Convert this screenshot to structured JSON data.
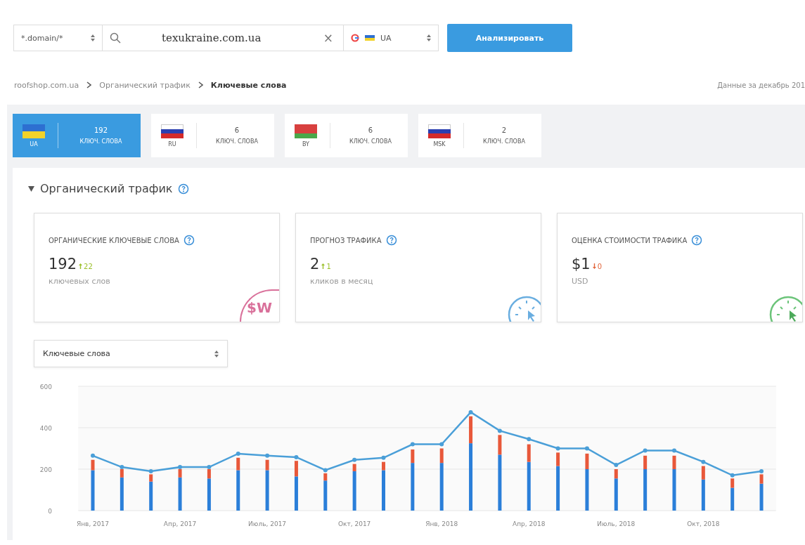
{
  "search_bar": {
    "mode_select": "*.domain/*",
    "query": "texukraine.com.ua",
    "clear": "×",
    "engine_select": "UA",
    "analyze_button": "Анализировать"
  },
  "breadcrumbs": [
    {
      "label": "roofshop.com.ua",
      "current": false
    },
    {
      "label": "Органический трафик",
      "current": false
    },
    {
      "label": "Ключевые слова",
      "current": true
    }
  ],
  "data_note": "Данные за декабрь 201",
  "region_tabs": [
    {
      "code": "UA",
      "count": "192",
      "label": "КЛЮЧ. СЛОВА",
      "selected": true,
      "kind": "ua"
    },
    {
      "code": "RU",
      "count": "6",
      "label": "КЛЮЧ. СЛОВА",
      "selected": false,
      "kind": "ru"
    },
    {
      "code": "BY",
      "count": "6",
      "label": "КЛЮЧ. СЛОВА",
      "selected": false,
      "kind": "by"
    },
    {
      "code": "MSK",
      "count": "2",
      "label": "КЛЮЧ. СЛОВА",
      "selected": false,
      "kind": "ru"
    }
  ],
  "section": {
    "title": "Органический трафик",
    "expanded": true
  },
  "cards": [
    {
      "title": "ОРГАНИЧЕСКИЕ КЛЮЧЕВЫЕ СЛОВА",
      "value": "192",
      "change": "22",
      "rising": true,
      "caption": "ключевых слов",
      "kind": "keywords",
      "badge": "$W"
    },
    {
      "title": "ПРОГНОЗ ТРАФИКА",
      "value": "2",
      "change": "1",
      "rising": true,
      "caption": "кликов в месяц",
      "kind": "clicks"
    },
    {
      "title": "ОЦЕНКА СТОИМОСТИ ТРАФИКА",
      "value": "$1",
      "change": "0",
      "rising": false,
      "caption": "USD",
      "kind": "cost"
    }
  ],
  "metric_select": "Ключевые слова",
  "chart_data": {
    "type": "bar",
    "stacked": true,
    "categories": [
      "Янв, 2017",
      null,
      null,
      "Апр, 2017",
      null,
      null,
      "Июль, 2017",
      null,
      null,
      "Окт, 2017",
      null,
      null,
      "Янв, 2018",
      null,
      null,
      "Апр, 2018",
      null,
      null,
      "Июль, 2018",
      null,
      null,
      "Окт, 2018",
      null,
      null
    ],
    "ylim": [
      0,
      600
    ],
    "yticks": [
      0,
      200,
      400,
      600
    ],
    "series": [
      {
        "color": "#2b7fd9",
        "values": [
          195,
          160,
          140,
          160,
          155,
          195,
          195,
          165,
          145,
          190,
          195,
          230,
          230,
          325,
          270,
          235,
          215,
          200,
          155,
          200,
          200,
          150,
          110,
          130
        ]
      },
      {
        "color": "#e8583a",
        "values": [
          50,
          40,
          35,
          40,
          45,
          60,
          50,
          75,
          35,
          35,
          40,
          65,
          70,
          130,
          95,
          85,
          65,
          75,
          45,
          65,
          65,
          65,
          45,
          45
        ]
      },
      {
        "type": "line",
        "marker": "o",
        "color": "#4a9fd8",
        "values": [
          265,
          210,
          190,
          210,
          210,
          275,
          265,
          258,
          195,
          245,
          255,
          320,
          320,
          475,
          385,
          345,
          300,
          300,
          220,
          290,
          290,
          235,
          170,
          190
        ]
      }
    ]
  }
}
